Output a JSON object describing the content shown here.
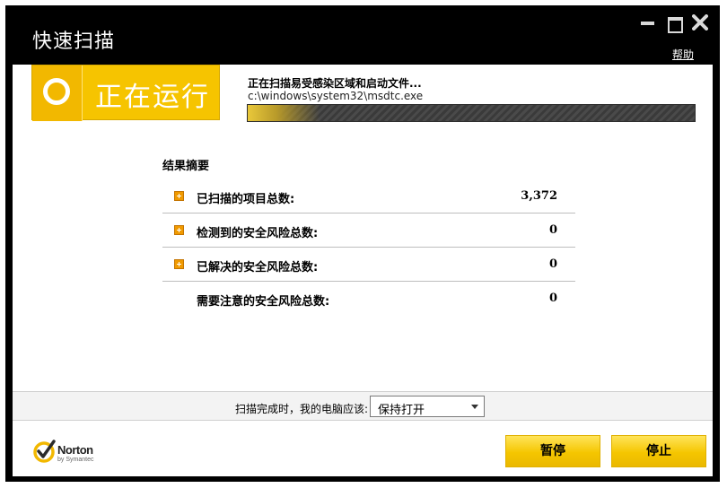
{
  "window": {
    "title": "快速扫描",
    "help_label": "帮助"
  },
  "status": {
    "label": "正在运行",
    "scan_heading": "正在扫描易受感染区域和启动文件...",
    "scan_path": "c:\\windows\\system32\\msdtc.exe"
  },
  "summary": {
    "title": "结果摘要",
    "rows": [
      {
        "label": "已扫描的项目总数:",
        "value": "3,372"
      },
      {
        "label": "检测到的安全风险总数:",
        "value": "0"
      },
      {
        "label": "已解决的安全风险总数:",
        "value": "0"
      },
      {
        "label": "需要注意的安全风险总数:",
        "value": "0"
      }
    ]
  },
  "post_scan": {
    "label": "扫描完成时，我的电脑应该:",
    "selected": "保持打开"
  },
  "footer": {
    "brand": "Norton",
    "brand_sub": "by Symantec",
    "pause_label": "暂停",
    "stop_label": "停止"
  },
  "colors": {
    "accent": "#f6c400",
    "title_bar": "#000000",
    "expander": "#f09a00"
  },
  "icons": [
    "minimize-icon",
    "maximize-icon",
    "close-icon",
    "status-ring-icon",
    "expand-plus-icon",
    "dropdown-arrow-icon",
    "norton-check-icon"
  ]
}
